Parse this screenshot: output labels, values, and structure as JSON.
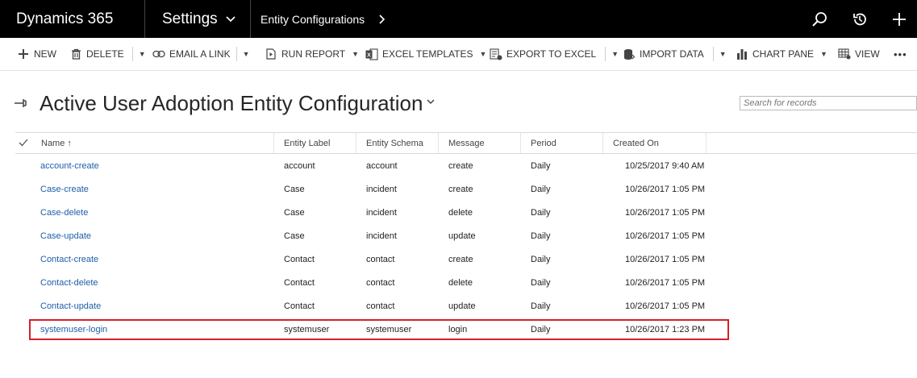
{
  "topbar": {
    "brand": "Dynamics 365",
    "area": "Settings",
    "breadcrumb": "Entity Configurations",
    "icons": [
      "search-icon",
      "history-icon",
      "plus-icon"
    ]
  },
  "commands": {
    "new": "NEW",
    "delete": "DELETE",
    "email_link": "EMAIL A LINK",
    "run_report": "RUN REPORT",
    "excel_templates": "EXCEL TEMPLATES",
    "export_excel": "EXPORT TO EXCEL",
    "import_data": "IMPORT DATA",
    "chart_pane": "CHART PANE",
    "view": "VIEW",
    "more": "•••"
  },
  "view": {
    "title": "Active User Adoption Entity Configuration",
    "search_placeholder": "Search for records"
  },
  "grid": {
    "columns": [
      "Name ↑",
      "Entity Label",
      "Entity Schema",
      "Message",
      "Period",
      "Created On"
    ],
    "rows": [
      [
        "account-create",
        "account",
        "account",
        "create",
        "Daily",
        "10/25/2017 9:40 AM"
      ],
      [
        "Case-create",
        "Case",
        "incident",
        "create",
        "Daily",
        "10/26/2017 1:05 PM"
      ],
      [
        "Case-delete",
        "Case",
        "incident",
        "delete",
        "Daily",
        "10/26/2017 1:05 PM"
      ],
      [
        "Case-update",
        "Case",
        "incident",
        "update",
        "Daily",
        "10/26/2017 1:05 PM"
      ],
      [
        "Contact-create",
        "Contact",
        "contact",
        "create",
        "Daily",
        "10/26/2017 1:05 PM"
      ],
      [
        "Contact-delete",
        "Contact",
        "contact",
        "delete",
        "Daily",
        "10/26/2017 1:05 PM"
      ],
      [
        "Contact-update",
        "Contact",
        "contact",
        "update",
        "Daily",
        "10/26/2017 1:05 PM"
      ],
      [
        "systemuser-login",
        "systemuser",
        "systemuser",
        "login",
        "Daily",
        "10/26/2017 1:23 PM"
      ]
    ],
    "highlighted_row": 7
  },
  "colors": {
    "topbar": "#000000",
    "link": "#1f5ea8",
    "highlight": "#d7202b"
  }
}
